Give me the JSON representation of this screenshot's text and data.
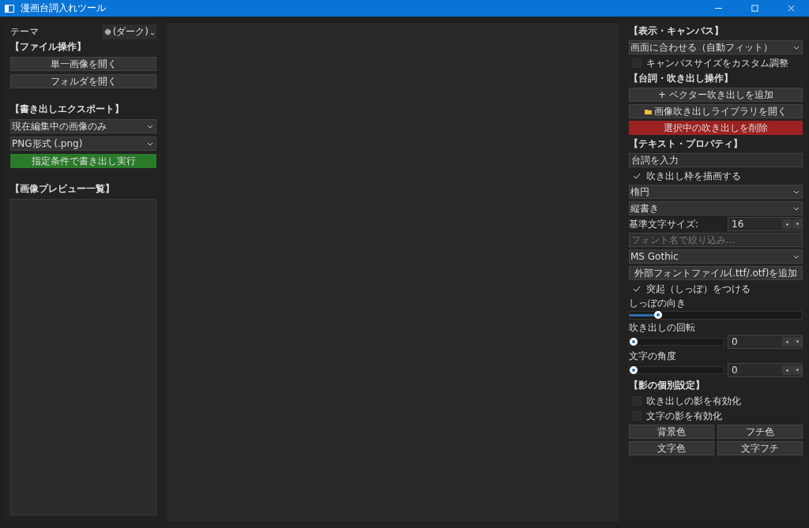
{
  "window": {
    "title": "漫画台詞入れツール"
  },
  "left_panel": {
    "theme_label": "テーマ",
    "theme_button": "(ダーク)",
    "items": [
      {
        "kind": "header",
        "text": "【ファイル操作】"
      },
      {
        "kind": "button",
        "text": "単一画像を開く"
      },
      {
        "kind": "button",
        "text": "フォルダを開く"
      },
      {
        "kind": "spacer"
      },
      {
        "kind": "header",
        "text": "【書き出しエクスポート】"
      },
      {
        "kind": "select",
        "text": "現在編集中の画像のみ"
      },
      {
        "kind": "select",
        "text": "PNG形式 (.png)"
      },
      {
        "kind": "primary_button",
        "text": "指定条件で書き出し実行"
      },
      {
        "kind": "spacer"
      },
      {
        "kind": "header",
        "text": "【画像プレビュー一覧】"
      }
    ]
  },
  "right_panel": {
    "items": [
      {
        "kind": "header",
        "text": "【表示・キャンバス】"
      },
      {
        "kind": "select",
        "text": "画面に合わせる（自動フィット）"
      },
      {
        "kind": "checkbox",
        "text": "キャンバスサイズをカスタム調整",
        "checked": false
      },
      {
        "kind": "header",
        "text": "【台詞・吹き出し操作】"
      },
      {
        "kind": "button",
        "text": "+ ベクター吹き出しを追加"
      },
      {
        "kind": "icon_button",
        "text": "画像吹き出しライブラリを開く"
      },
      {
        "kind": "danger_button",
        "text": "選択中の吹き出しを削除"
      },
      {
        "kind": "header",
        "text": "【テキスト・プロパティ】"
      },
      {
        "kind": "input",
        "value": "台詞を入力"
      },
      {
        "kind": "checkbox",
        "text": "吹き出し枠を描画する",
        "checked": true
      },
      {
        "kind": "select",
        "text": "楕円"
      },
      {
        "kind": "select",
        "text": "縦書き"
      },
      {
        "kind": "spin_row",
        "text": "基準文字サイズ:",
        "value": "16"
      },
      {
        "kind": "input",
        "placeholder": "フォント名で絞り込み..."
      },
      {
        "kind": "select",
        "text": "MS Gothic"
      },
      {
        "kind": "button",
        "text": "外部フォントファイル(.ttf/.otf)を追加"
      },
      {
        "kind": "checkbox",
        "text": "突起（しっぽ）をつける",
        "checked": true
      },
      {
        "kind": "label",
        "text": "しっぽの向き"
      },
      {
        "kind": "slider",
        "level": 0.15
      },
      {
        "kind": "label",
        "text": "吹き出しの回転"
      },
      {
        "kind": "slider_spin",
        "level": 0,
        "value": "0"
      },
      {
        "kind": "label",
        "text": "文字の角度"
      },
      {
        "kind": "slider_spin",
        "level": 0,
        "value": "0"
      },
      {
        "kind": "header",
        "text": "【影の個別設定】"
      },
      {
        "kind": "checkbox",
        "text": "吹き出しの影を有効化",
        "checked": false
      },
      {
        "kind": "checkbox",
        "text": "文字の影を有効化",
        "checked": false
      },
      {
        "kind": "button_pair",
        "texts": [
          "背景色",
          "フチ色"
        ]
      },
      {
        "kind": "button_pair",
        "texts": [
          "文字色",
          "文字フチ"
        ]
      }
    ]
  }
}
